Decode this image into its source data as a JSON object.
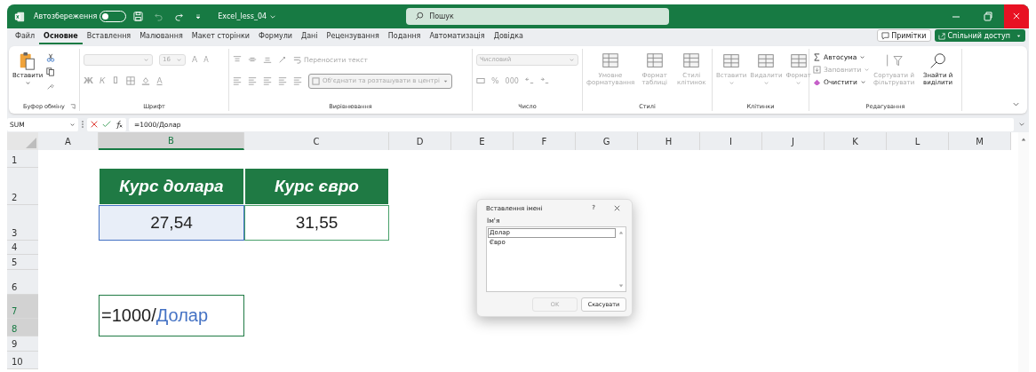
{
  "title_bar": {
    "autosave_label": "Автозбереження",
    "autosave_on": false,
    "file_name": "Excel_less_04",
    "search_placeholder": "Пошук"
  },
  "tabs": [
    {
      "label": "Файл",
      "selected": false
    },
    {
      "label": "Основне",
      "selected": true
    },
    {
      "label": "Вставлення",
      "selected": false
    },
    {
      "label": "Малювання",
      "selected": false
    },
    {
      "label": "Макет сторінки",
      "selected": false
    },
    {
      "label": "Формули",
      "selected": false
    },
    {
      "label": "Дані",
      "selected": false
    },
    {
      "label": "Рецензування",
      "selected": false
    },
    {
      "label": "Подання",
      "selected": false
    },
    {
      "label": "Автоматизація",
      "selected": false
    },
    {
      "label": "Довідка",
      "selected": false
    }
  ],
  "comments_button": "Примітки",
  "share_button": "Спільний доступ",
  "ribbon": {
    "clipboard": {
      "paste": "Вставити",
      "group": "Буфер обміну"
    },
    "font": {
      "size": "16",
      "grow": "A",
      "shrink": "A",
      "bold": "Ж",
      "italic": "К",
      "font_color": "A",
      "group": "Шрифт",
      "disabled": true
    },
    "alignment": {
      "wrap": "Переносити текст",
      "merge": "Об'єднати та розташувати в центрі",
      "group": "Вирівнювання",
      "disabled": true
    },
    "number": {
      "format": "Числовий",
      "percent": "%",
      "thousands": "000",
      "group": "Число",
      "disabled": true
    },
    "styles": {
      "tools": [
        "Умовне форматування",
        "Формат таблиці",
        "Стилі клітинок"
      ],
      "group": "Стилі",
      "disabled": true
    },
    "cells": {
      "tools": [
        "Вставити",
        "Видалити",
        "Формат"
      ],
      "group": "Клітинки",
      "disabled": true
    },
    "editing": {
      "autosum": {
        "label": "Автосума",
        "disabled": false
      },
      "fill": {
        "label": "Заповнити",
        "disabled": true
      },
      "clear": {
        "label": "Очистити",
        "disabled": false
      },
      "sort": {
        "label": "Сортувати й фільтрувати",
        "disabled": true
      },
      "find": {
        "label": "Знайти й виділити",
        "disabled": false
      },
      "group": "Редагування"
    }
  },
  "formula_bar": {
    "name_box": "SUM",
    "formula": "=1000/Долар"
  },
  "sheet": {
    "columns": [
      {
        "label": "A",
        "selected": false
      },
      {
        "label": "B",
        "selected": true
      },
      {
        "label": "C",
        "selected": false
      },
      {
        "label": "D",
        "selected": false
      },
      {
        "label": "E",
        "selected": false
      },
      {
        "label": "F",
        "selected": false
      },
      {
        "label": "G",
        "selected": false
      },
      {
        "label": "H",
        "selected": false
      },
      {
        "label": "I",
        "selected": false
      },
      {
        "label": "J",
        "selected": false
      },
      {
        "label": "K",
        "selected": false
      },
      {
        "label": "L",
        "selected": false
      },
      {
        "label": "M",
        "selected": false
      }
    ],
    "rows": [
      {
        "label": "1",
        "selected": false
      },
      {
        "label": "2",
        "selected": false,
        "cells": [
          null,
          {
            "kind": "header",
            "text": "Курс долара"
          },
          {
            "kind": "header",
            "text": "Курс євро"
          }
        ]
      },
      {
        "label": "3",
        "selected": false,
        "cells": [
          null,
          {
            "kind": "value",
            "text": "27,54",
            "color": "#4472c4"
          },
          {
            "kind": "value",
            "text": "31,55"
          }
        ]
      },
      {
        "label": "4",
        "selected": false
      },
      {
        "label": "5",
        "selected": false
      },
      {
        "label": "6",
        "selected": false
      },
      {
        "label": "7",
        "selected": true,
        "cells": [
          null,
          {
            "kind": "editing",
            "merge_down": true,
            "parts": [
              {
                "text": "=1000/"
              },
              {
                "text": "Долар",
                "color": "#4472c4"
              }
            ]
          }
        ]
      },
      {
        "label": "8",
        "selected": true
      },
      {
        "label": "9",
        "selected": false
      },
      {
        "label": "10",
        "selected": false
      }
    ]
  },
  "dialog": {
    "title": "Вставлення імені",
    "help": "?",
    "label": "Ім'я",
    "items": [
      {
        "label": "Долар",
        "selected": true
      },
      {
        "label": "Євро",
        "selected": false
      }
    ],
    "buttons": [
      {
        "label": "OK",
        "disabled": true
      },
      {
        "label": "Скасувати",
        "disabled": false
      }
    ]
  }
}
